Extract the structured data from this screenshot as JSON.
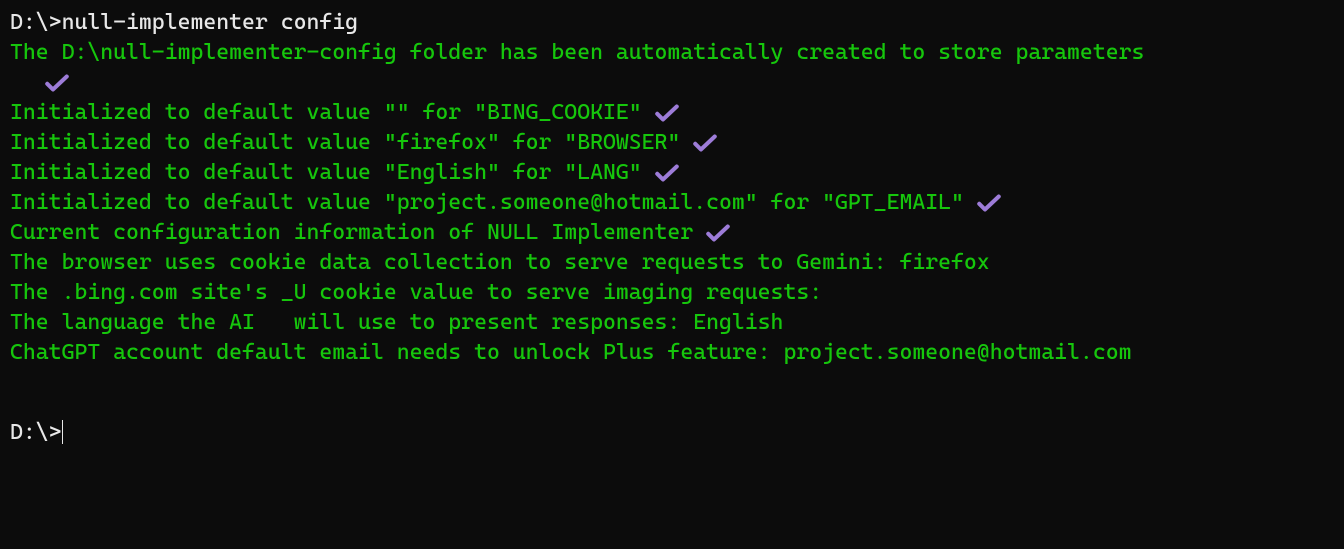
{
  "terminal": {
    "prompt1": "D:\\>",
    "command": "null-implementer config",
    "lines": {
      "folder_created": "The D:\\null-implementer-config folder has been automatically created to store parameters",
      "init_bing": "Initialized to default value \"\" for \"BING_COOKIE\"",
      "init_browser": "Initialized to default value \"firefox\" for \"BROWSER\"",
      "init_lang": "Initialized to default value \"English\" for \"LANG\"",
      "init_email": "Initialized to default value \"project.someone@hotmail.com\" for \"GPT_EMAIL\"",
      "current_config": "Current configuration information of NULL Implementer",
      "browser_desc": "The browser uses cookie data collection to serve requests to Gemini: firefox",
      "bing_desc": "The .bing.com site's _U cookie value to serve imaging requests:",
      "lang_desc": "The language the AI   will use to present responses: English",
      "email_desc": "ChatGPT account default email needs to unlock Plus feature: project.someone@hotmail.com"
    },
    "prompt2": "D:\\>"
  }
}
